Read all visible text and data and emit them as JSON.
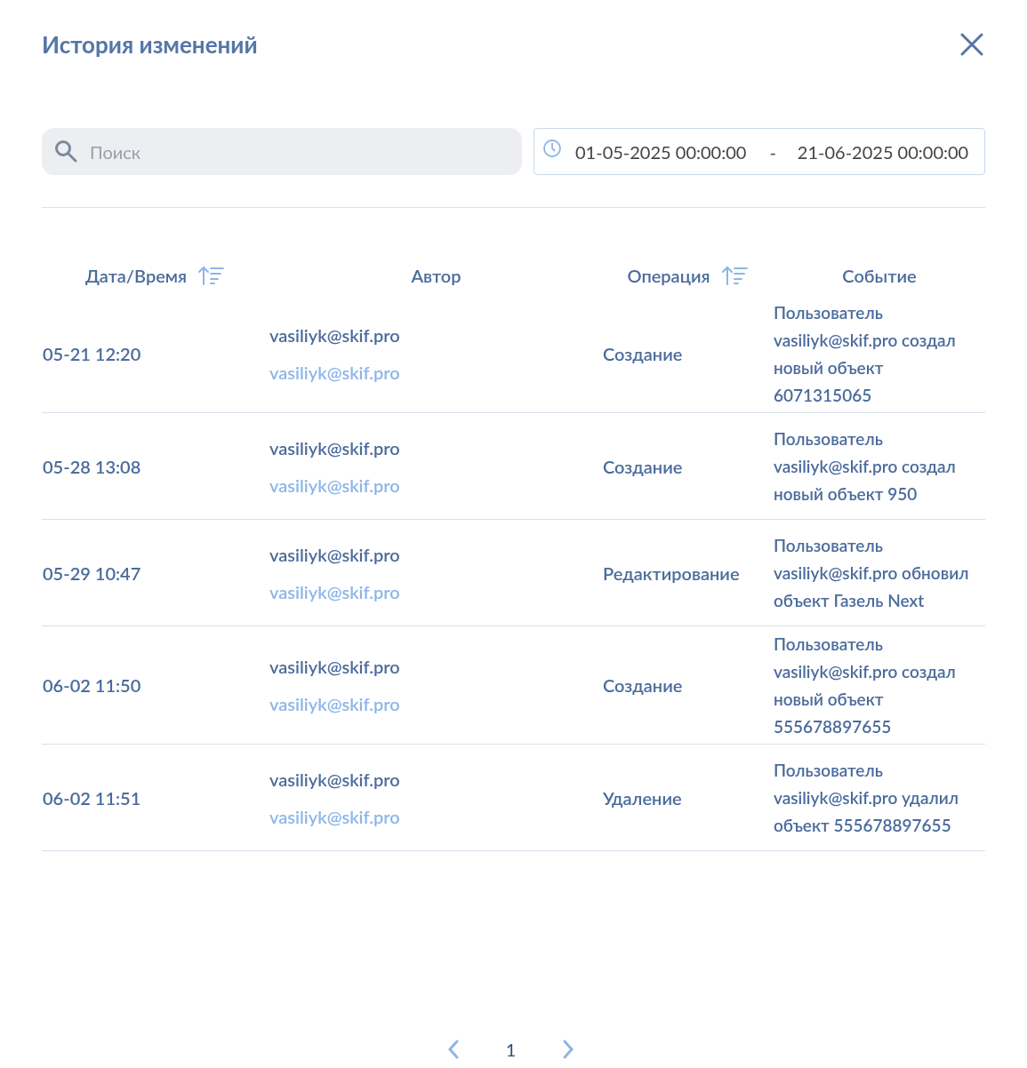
{
  "dialog": {
    "title": "История изменений"
  },
  "search": {
    "placeholder": "Поиск"
  },
  "date_range": {
    "from": "01-05-2025 00:00:00",
    "separator": "-",
    "to": "21-06-2025 00:00:00"
  },
  "table": {
    "columns": [
      {
        "label": "Дата/Время",
        "sortable": true
      },
      {
        "label": "Автор",
        "sortable": false
      },
      {
        "label": "Операция",
        "sortable": true
      },
      {
        "label": "Событие",
        "sortable": false
      }
    ],
    "rows": [
      {
        "datetime": "05-21 12:20",
        "author": "vasiliyk@skif.pro",
        "author_login": "vasiliyk@skif.pro",
        "operation": "Создание",
        "event": "Пользователь vasiliyk@skif.pro создал новый объект 6071315065"
      },
      {
        "datetime": "05-28 13:08",
        "author": "vasiliyk@skif.pro",
        "author_login": "vasiliyk@skif.pro",
        "operation": "Создание",
        "event": "Пользователь vasiliyk@skif.pro создал новый объект 950"
      },
      {
        "datetime": "05-29 10:47",
        "author": "vasiliyk@skif.pro",
        "author_login": "vasiliyk@skif.pro",
        "operation": "Редактирование",
        "event": "Пользователь vasiliyk@skif.pro обновил объект Газель Next"
      },
      {
        "datetime": "06-02 11:50",
        "author": "vasiliyk@skif.pro",
        "author_login": "vasiliyk@skif.pro",
        "operation": "Создание",
        "event": "Пользователь vasiliyk@skif.pro создал новый объект 555678897655"
      },
      {
        "datetime": "06-02 11:51",
        "author": "vasiliyk@skif.pro",
        "author_login": "vasiliyk@skif.pro",
        "operation": "Удаление",
        "event": "Пользователь vasiliyk@skif.pro удалил объект 555678897655"
      }
    ]
  },
  "pagination": {
    "pages": [
      {
        "label": "1",
        "selected": true
      }
    ]
  }
}
